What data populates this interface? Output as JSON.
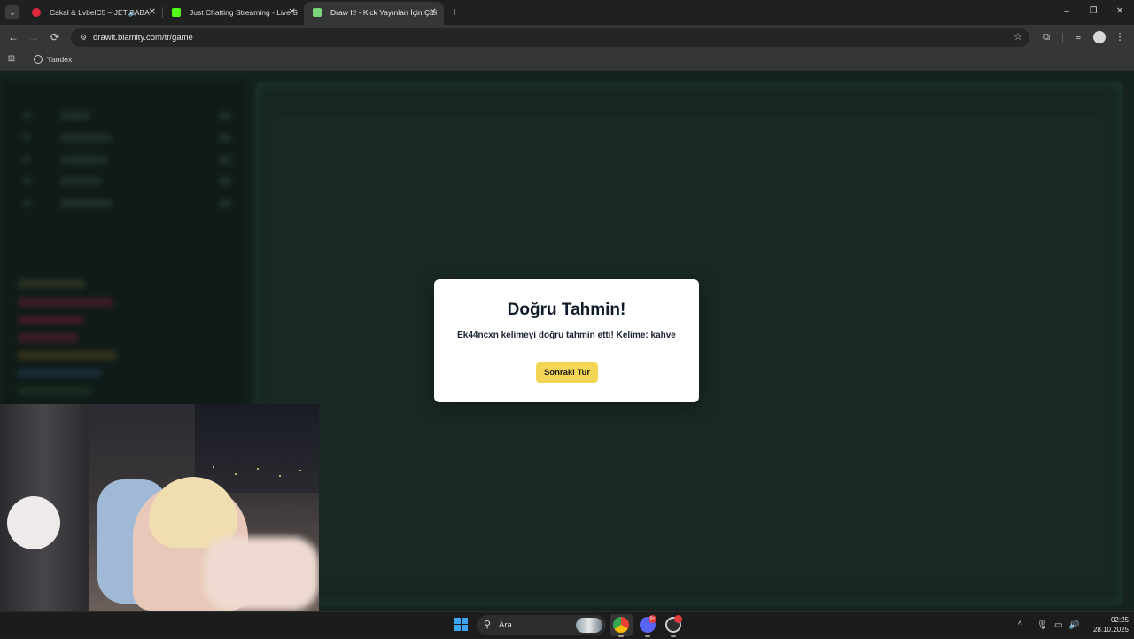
{
  "browser": {
    "tabs": [
      {
        "title": "Cakal & LvbelC5 – JET BABA",
        "favicon_color": "#e0283c",
        "audio": true,
        "active": false
      },
      {
        "title": "Just Chatting Streaming - Live S",
        "favicon_color": "#53fc18",
        "audio": false,
        "active": false
      },
      {
        "title": "Draw It! - Kick Yayınları İçin Çizi",
        "favicon_color": "#7bd67b",
        "audio": false,
        "active": true
      }
    ],
    "url": "drawit.blamity.com/tr/game",
    "bookmarks": [
      {
        "label": "Yandex"
      }
    ]
  },
  "icons": {
    "tab_menu": "⌄",
    "close": "✕",
    "speaker": "🔈",
    "new_tab": "+",
    "minimize": "–",
    "restore": "❐",
    "win_close": "✕",
    "back": "←",
    "forward": "→",
    "reload": "⟳",
    "site_info": "⚙",
    "star": "☆",
    "extensions": "⧉",
    "media": "≡",
    "more": "⋮",
    "apps": "⊞",
    "search": "⚲",
    "chevron_up": "^",
    "mic": "🎙",
    "display": "▭",
    "volume": "🔊"
  },
  "modal": {
    "title": "Doğru Tahmin!",
    "message": "Ek44ncxn kelimeyi doğru tahmin etti! Kelime: kahve",
    "button": "Sonraki Tur"
  },
  "taskbar": {
    "search_label": "Ara",
    "discord_badge": "9+",
    "time": "02:25",
    "date": "28.10.2025"
  }
}
